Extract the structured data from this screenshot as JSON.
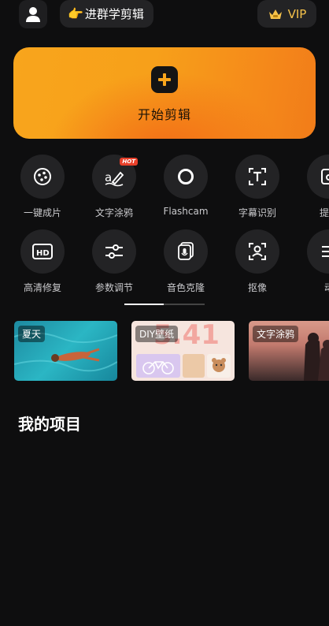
{
  "header": {
    "group_icon": "👉",
    "group_label": "进群学剪辑",
    "vip_label": "VIP",
    "vip_color": "#f6c24a"
  },
  "start": {
    "label": "开始剪辑",
    "gradient": [
      "#f8a51c",
      "#f17c19"
    ]
  },
  "tools_row1": [
    {
      "icon": "film-reel-icon",
      "label": "一键成片"
    },
    {
      "icon": "text-brush-icon",
      "label": "文字涂鸦",
      "badge": "HOT"
    },
    {
      "icon": "circle-ring-icon",
      "label": "Flashcam"
    },
    {
      "icon": "text-box-icon",
      "label": "字幕识别"
    },
    {
      "icon": "extract-icon",
      "label": "提取"
    }
  ],
  "tools_row2": [
    {
      "icon": "hd-icon",
      "label": "高清修复"
    },
    {
      "icon": "sliders-icon",
      "label": "参数调节"
    },
    {
      "icon": "voice-clone-icon",
      "label": "音色克隆"
    },
    {
      "icon": "portrait-cutout-icon",
      "label": "抠像"
    },
    {
      "icon": "animation-icon",
      "label": "动"
    }
  ],
  "banners": [
    {
      "tag": "夏天"
    },
    {
      "tag": "DIY壁纸",
      "overlay_text": "5.41"
    },
    {
      "tag": "文字涂鸦"
    }
  ],
  "projects_title": "我的项目"
}
